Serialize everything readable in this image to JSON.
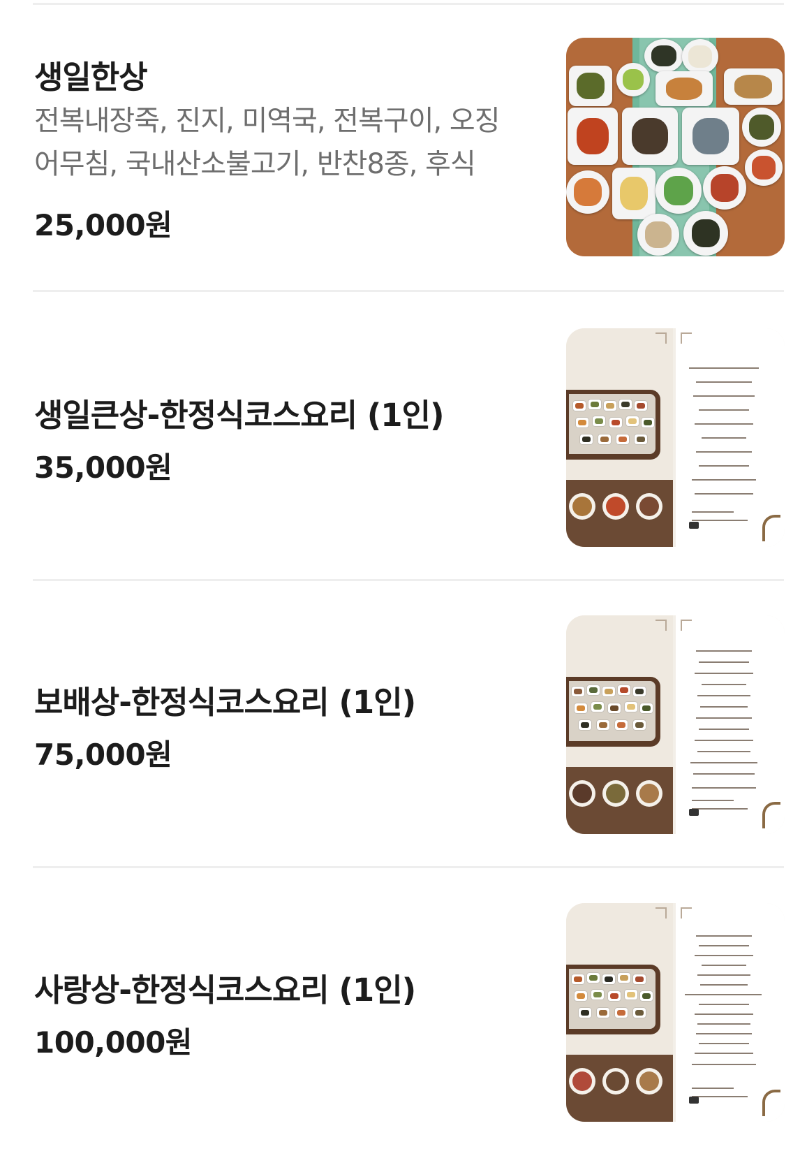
{
  "menu": {
    "items": [
      {
        "name": "생일한상",
        "description_lines": [
          "전복내장죽, 진지, 미역국, 전복구이, 오징",
          "어무침, 국내산소불고기, 반찬8종, 후식"
        ],
        "price": "25,000원",
        "thumbnail": "food-photo"
      },
      {
        "name": "생일큰상-한정식코스요리 (1인)",
        "price": "35,000원",
        "thumbnail": "menu-poster"
      },
      {
        "name": "보배상-한정식코스요리 (1인)",
        "price": "75,000원",
        "thumbnail": "menu-poster"
      },
      {
        "name": "사랑상-한정식코스요리 (1인)",
        "price": "100,000원",
        "thumbnail": "menu-poster"
      }
    ]
  },
  "colors": {
    "divider": "#eeeeee",
    "text_primary": "#1c1c1c",
    "text_secondary": "#6e6e6e",
    "poster_brown": "#6b4a34"
  }
}
